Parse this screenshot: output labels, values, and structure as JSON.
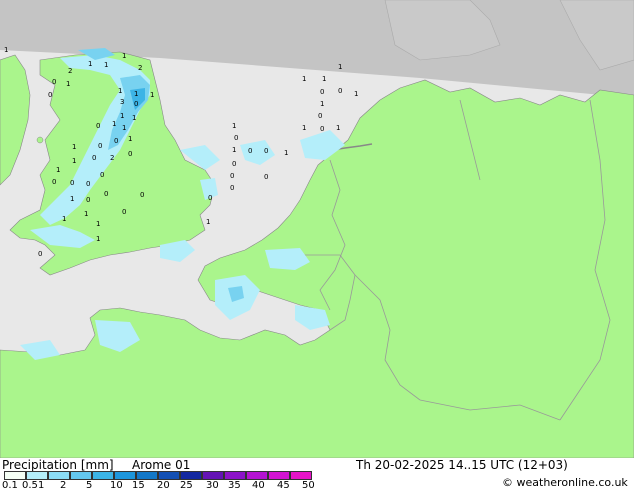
{
  "title": "Precipitation [mm]",
  "model": "Arome 01",
  "datetime": "Th 20-02-2025 14..15 UTC (12+03)",
  "credit": "© weatheronline.co.uk",
  "colors": {
    "sea": "#e8e8e8",
    "land": "#aaf58c",
    "outside_domain": "#c4c4c4",
    "light_rain": "#b4eefa",
    "moderate_rain": "#78d2f0",
    "heavy_rain": "#3cb4e6",
    "border": "#999999"
  },
  "legend": {
    "ticks": [
      "0.1",
      "0.5",
      "1",
      "2",
      "5",
      "10",
      "15",
      "20",
      "25",
      "30",
      "35",
      "40",
      "45",
      "50"
    ],
    "colors": [
      "#f5fff5",
      "#b4eefa",
      "#8cdcf5",
      "#64c8f0",
      "#3cb4e6",
      "#1e96dc",
      "#1478c8",
      "#1450b4",
      "#1428a0",
      "#6414b4",
      "#8c14c8",
      "#b414d2",
      "#d214d2",
      "#e614c8"
    ]
  },
  "station_values": [
    "1",
    "2",
    "1",
    "1",
    "1",
    "2",
    "0",
    "1",
    "0",
    "1",
    "1",
    "3",
    "1",
    "0",
    "1",
    "1",
    "1",
    "1",
    "0",
    "0",
    "1",
    "0",
    "1",
    "1",
    "2",
    "0",
    "0",
    "1",
    "0",
    "0",
    "0",
    "0",
    "0",
    "1",
    "0",
    "1",
    "1",
    "1",
    "1",
    "0",
    "0",
    "0",
    "0",
    "1",
    "1",
    "0",
    "1",
    "0",
    "0",
    "0",
    "0",
    "0",
    "0",
    "1",
    "1",
    "0",
    "1",
    "1",
    "1",
    "1",
    "1",
    "0",
    "0",
    "1",
    "0"
  ]
}
